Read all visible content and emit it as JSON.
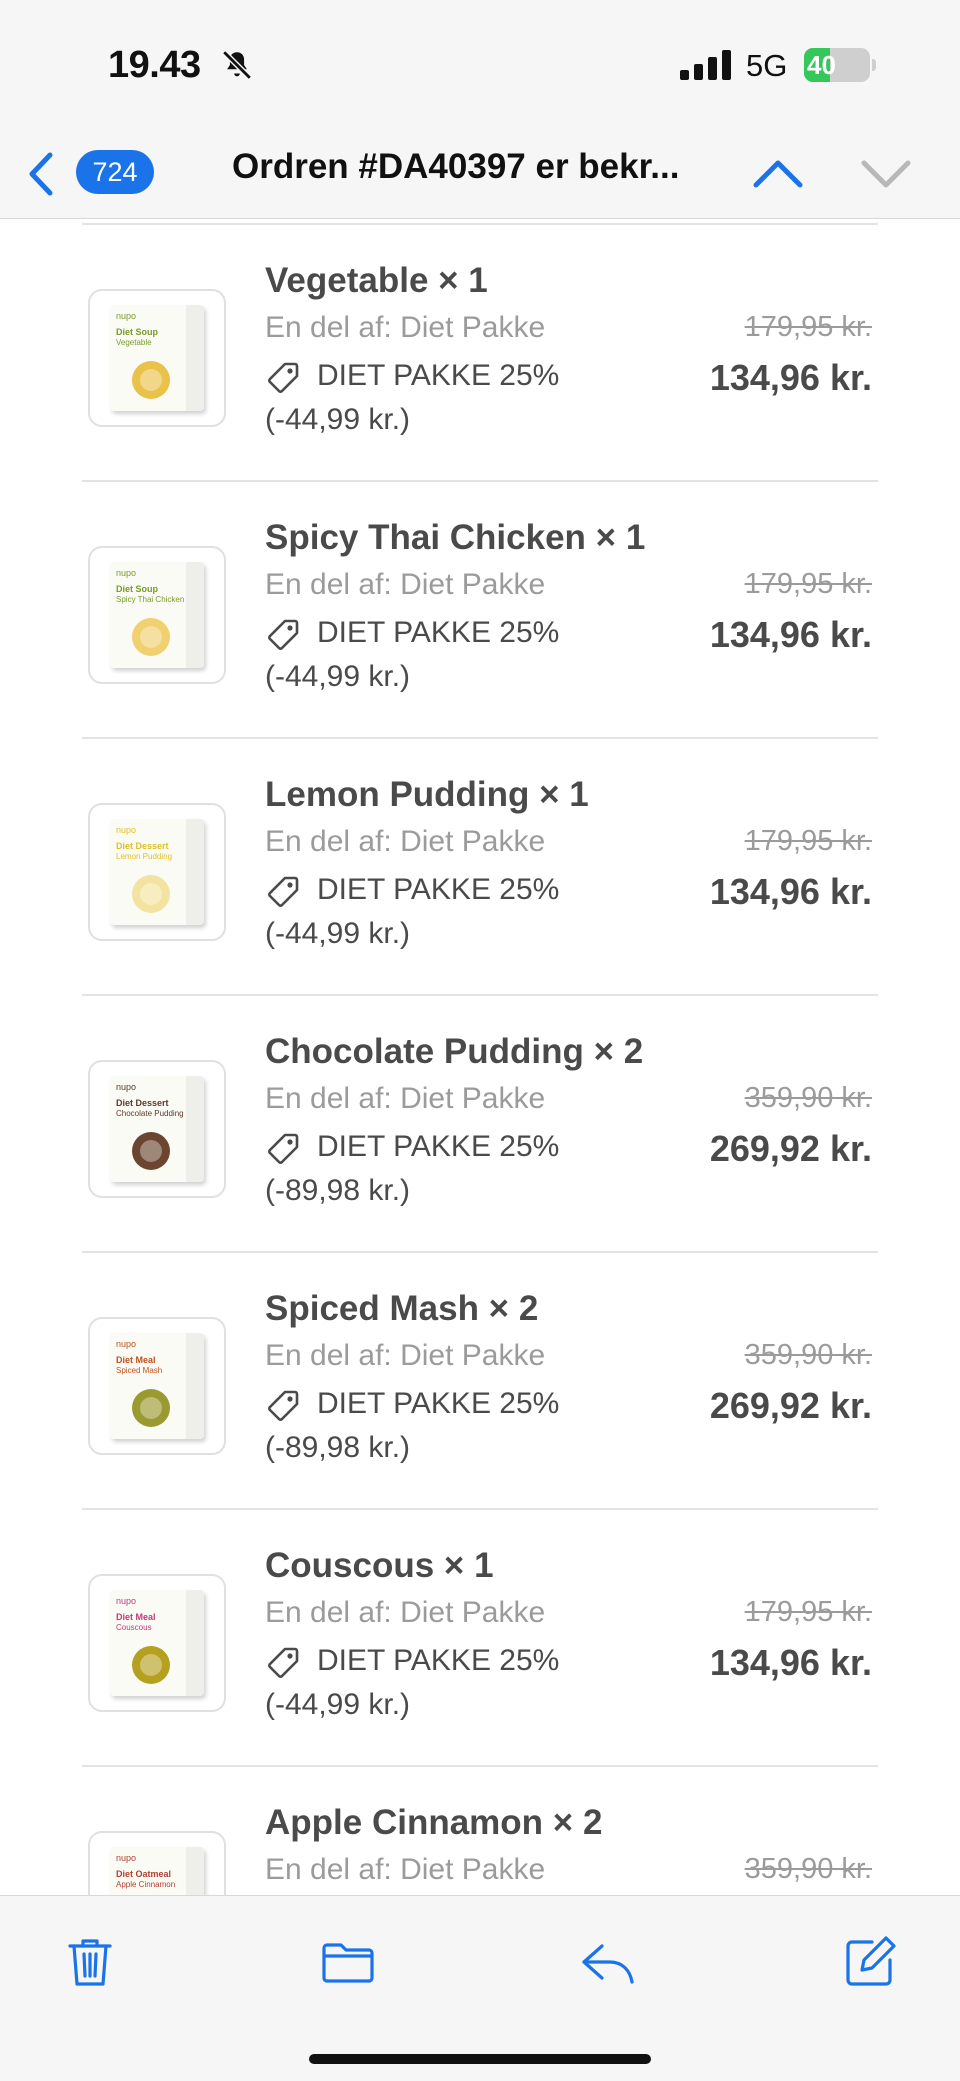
{
  "status_bar": {
    "time": "19.43",
    "network": "5G",
    "battery": "40",
    "battery_level": 0.4
  },
  "nav": {
    "badge": "724",
    "title": "Ordren #DA40397 er bekr..."
  },
  "items": [
    {
      "name": "Vegetable × 1",
      "sub": "En del af: Diet Pakke",
      "discount": "DIET PAKKE 25%",
      "saving": "(-44,99 kr.)",
      "original_price": "179,95 kr.",
      "price": "134,96 kr.",
      "thumb": {
        "brand": "nupo",
        "line1": "Diet Soup",
        "line2": "Vegetable",
        "accent": "#7a9a2a",
        "bowl": "#e9c24a"
      }
    },
    {
      "name": "Spicy Thai Chicken × 1",
      "sub": "En del af: Diet Pakke",
      "discount": "DIET PAKKE 25%",
      "saving": "(-44,99 kr.)",
      "original_price": "179,95 kr.",
      "price": "134,96 kr.",
      "thumb": {
        "brand": "nupo",
        "line1": "Diet Soup",
        "line2": "Spicy Thai Chicken",
        "accent": "#7a9a2a",
        "bowl": "#f0d070"
      }
    },
    {
      "name": "Lemon Pudding × 1",
      "sub": "En del af: Diet Pakke",
      "discount": "DIET PAKKE 25%",
      "saving": "(-44,99 kr.)",
      "original_price": "179,95 kr.",
      "price": "134,96 kr.",
      "thumb": {
        "brand": "nupo",
        "line1": "Diet Dessert",
        "line2": "Lemon Pudding",
        "accent": "#e0c020",
        "bowl": "#f3e3a0"
      }
    },
    {
      "name": "Chocolate Pudding × 2",
      "sub": "En del af: Diet Pakke",
      "discount": "DIET PAKKE 25%",
      "saving": "(-89,98 kr.)",
      "original_price": "359,90 kr.",
      "price": "269,92 kr.",
      "thumb": {
        "brand": "nupo",
        "line1": "Diet Dessert",
        "line2": "Chocolate Pudding",
        "accent": "#5a3a2a",
        "bowl": "#6b4530"
      }
    },
    {
      "name": "Spiced Mash × 2",
      "sub": "En del af: Diet Pakke",
      "discount": "DIET PAKKE 25%",
      "saving": "(-89,98 kr.)",
      "original_price": "359,90 kr.",
      "price": "269,92 kr.",
      "thumb": {
        "brand": "nupo",
        "line1": "Diet Meal",
        "line2": "Spiced Mash",
        "accent": "#c0501a",
        "bowl": "#9a9a30"
      }
    },
    {
      "name": "Couscous × 1",
      "sub": "En del af: Diet Pakke",
      "discount": "DIET PAKKE 25%",
      "saving": "(-44,99 kr.)",
      "original_price": "179,95 kr.",
      "price": "134,96 kr.",
      "thumb": {
        "brand": "nupo",
        "line1": "Diet Meal",
        "line2": "Couscous",
        "accent": "#c03a7a",
        "bowl": "#b5a020"
      }
    },
    {
      "name": "Apple Cinnamon × 2",
      "sub": "En del af: Diet Pakke",
      "discount": "",
      "saving": "",
      "original_price": "359,90 kr.",
      "price": "",
      "thumb": {
        "brand": "nupo",
        "line1": "Diet Oatmeal",
        "line2": "Apple Cinnamon",
        "accent": "#b04030",
        "bowl": "#d9b080"
      }
    }
  ],
  "toolbar": {
    "icons": [
      "trash-icon",
      "folder-icon",
      "reply-icon",
      "compose-icon"
    ],
    "accent": "#1a73e8"
  }
}
